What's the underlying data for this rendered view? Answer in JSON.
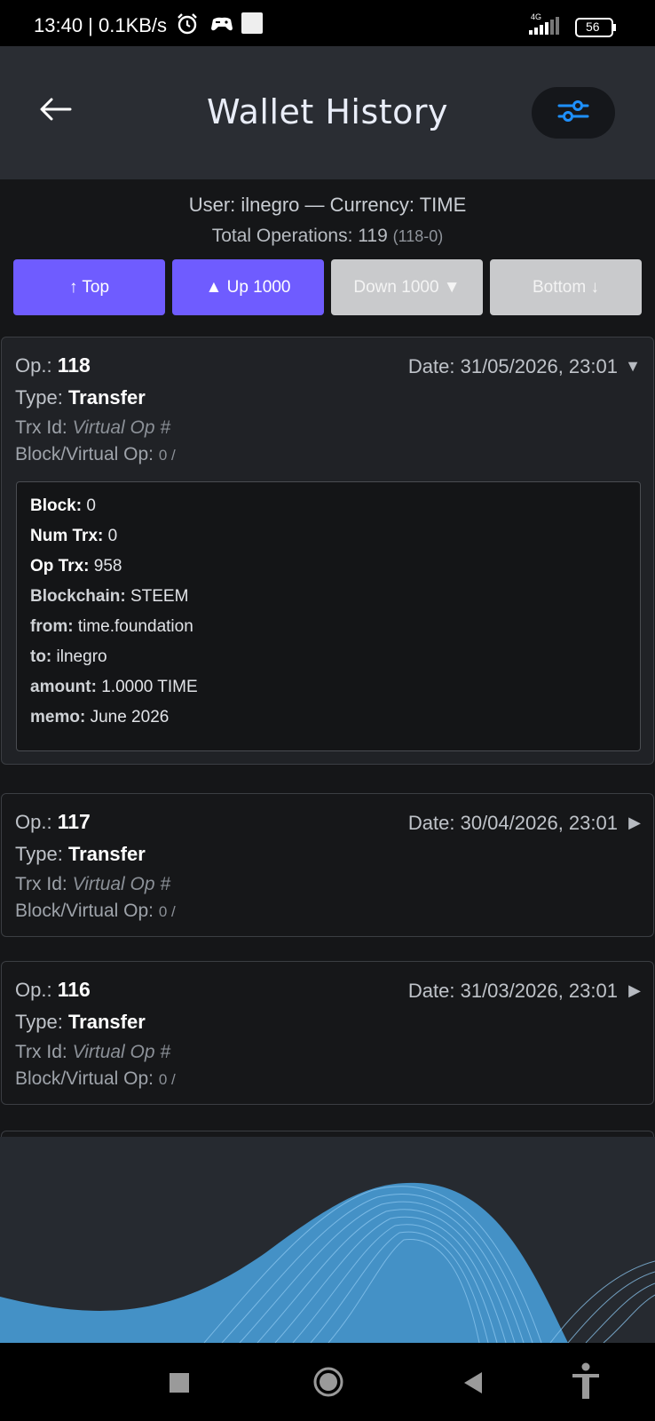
{
  "status_bar": {
    "time_speed": "13:40 | 0.1KB/s",
    "network": "4G",
    "battery": "56",
    "icons": [
      "alarm-icon",
      "game-controller-icon",
      "notification-square-icon",
      "signal-icon",
      "battery-icon"
    ]
  },
  "header": {
    "title": "Wallet History",
    "back_icon": "arrow-left-icon",
    "filter_icon": "sliders-icon"
  },
  "info": {
    "user_currency": "User: ilnegro — Currency: TIME",
    "total_label": "Total Operations: 119",
    "total_range": "(118-0)"
  },
  "nav_buttons": {
    "top": "↑ Top",
    "up": "▲ Up 1000",
    "down": "Down 1000 ▼",
    "bottom": "Bottom ↓"
  },
  "operations": [
    {
      "op_label": "Op.:",
      "op_number": "118",
      "date": "Date: 31/05/2026, 23:01",
      "arrow": "▼",
      "type_label": "Type:",
      "type": "Transfer",
      "trx_label": "Trx Id:",
      "trx_value": "Virtual Op #",
      "block_label": "Block/Virtual Op:",
      "block_value": "0 /",
      "details": [
        {
          "key": "Block:",
          "value": "0"
        },
        {
          "key": "Num Trx:",
          "value": "0"
        },
        {
          "key": "Op Trx:",
          "value": "958"
        },
        {
          "key": "Blockchain:",
          "value": "STEEM"
        },
        {
          "key": "from:",
          "value": "time.foundation"
        },
        {
          "key": "to:",
          "value": "ilnegro"
        },
        {
          "key": "amount:",
          "value": "1.0000 TIME"
        },
        {
          "key": "memo:",
          "value": "June 2026"
        }
      ]
    },
    {
      "op_label": "Op.:",
      "op_number": "117",
      "date": "Date: 30/04/2026, 23:01",
      "arrow": "▶",
      "type_label": "Type:",
      "type": "Transfer",
      "trx_label": "Trx Id:",
      "trx_value": "Virtual Op #",
      "block_label": "Block/Virtual Op:",
      "block_value": "0 /"
    },
    {
      "op_label": "Op.:",
      "op_number": "116",
      "date": "Date: 31/03/2026, 23:01",
      "arrow": "▶",
      "type_label": "Type:",
      "type": "Transfer",
      "trx_label": "Trx Id:",
      "trx_value": "Virtual Op #",
      "block_label": "Block/Virtual Op:",
      "block_value": "0 /"
    }
  ],
  "nav_bar": {
    "icons": [
      "recents-square-icon",
      "home-circle-icon",
      "back-triangle-icon",
      "accessibility-icon"
    ]
  },
  "colors": {
    "accent_button": "#6f5cff",
    "disabled_button": "#c9cacc",
    "header_bg": "#2a2d33",
    "filter_icon": "#1e90ff",
    "wave": "#5aa9e6"
  }
}
